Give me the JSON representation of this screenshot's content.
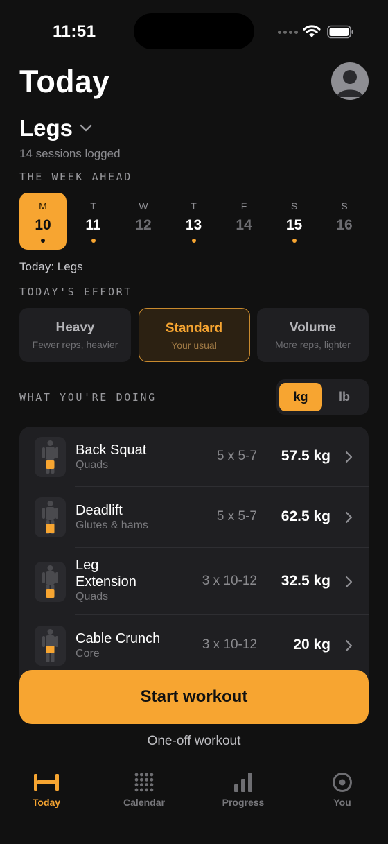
{
  "status": {
    "time": "11:51"
  },
  "header": {
    "title": "Today"
  },
  "program": {
    "name": "Legs",
    "sessions": "14 sessions logged"
  },
  "week": {
    "label": "THE WEEK AHEAD",
    "days": [
      {
        "letter": "M",
        "date": "10",
        "active": true,
        "dot": true,
        "strong": true
      },
      {
        "letter": "T",
        "date": "11",
        "active": false,
        "dot": true,
        "strong": true
      },
      {
        "letter": "W",
        "date": "12",
        "active": false,
        "dot": false,
        "strong": false
      },
      {
        "letter": "T",
        "date": "13",
        "active": false,
        "dot": true,
        "strong": true
      },
      {
        "letter": "F",
        "date": "14",
        "active": false,
        "dot": false,
        "strong": false
      },
      {
        "letter": "S",
        "date": "15",
        "active": false,
        "dot": true,
        "strong": true
      },
      {
        "letter": "S",
        "date": "16",
        "active": false,
        "dot": false,
        "strong": false
      }
    ],
    "today_line": "Today: Legs"
  },
  "effort": {
    "label": "TODAY'S EFFORT",
    "options": [
      {
        "title": "Heavy",
        "subtitle": "Fewer reps, heavier",
        "selected": false
      },
      {
        "title": "Standard",
        "subtitle": "Your usual",
        "selected": true
      },
      {
        "title": "Volume",
        "subtitle": "More reps, lighter",
        "selected": false
      }
    ]
  },
  "exercises": {
    "label": "WHAT YOU'RE DOING",
    "units": {
      "kg": "kg",
      "lb": "lb",
      "selected": "kg"
    },
    "items": [
      {
        "name": "Back Squat",
        "muscle": "Quads",
        "scheme": "5 x 5-7",
        "weight": "57.5 kg"
      },
      {
        "name": "Deadlift",
        "muscle": "Glutes & hams",
        "scheme": "5 x 5-7",
        "weight": "62.5 kg"
      },
      {
        "name": "Leg Extension",
        "name_lines": [
          "Leg",
          "Extension"
        ],
        "muscle": "Quads",
        "scheme": "3 x 10-12",
        "weight": "32.5 kg"
      },
      {
        "name": "Cable Crunch",
        "muscle": "Core",
        "scheme": "3 x 10-12",
        "weight": "20 kg"
      }
    ]
  },
  "actions": {
    "start": "Start workout",
    "oneoff": "One-off workout"
  },
  "tabbar": {
    "tabs": [
      {
        "label": "Today",
        "icon": "dumbbell-icon",
        "active": true
      },
      {
        "label": "Calendar",
        "icon": "calendar-dots-icon",
        "active": false
      },
      {
        "label": "Progress",
        "icon": "bar-chart-icon",
        "active": false
      },
      {
        "label": "You",
        "icon": "profile-target-icon",
        "active": false
      }
    ]
  },
  "colors": {
    "accent": "#f7a531",
    "background": "#111111",
    "card": "#1f1f22"
  }
}
